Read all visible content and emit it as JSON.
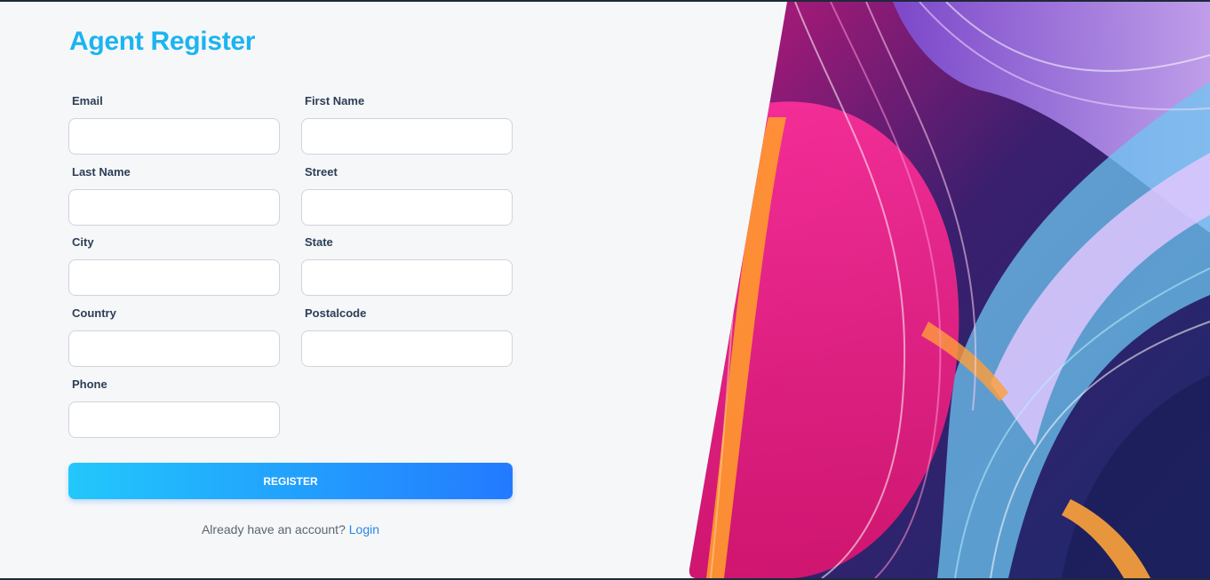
{
  "form": {
    "title": "Agent Register",
    "fields": {
      "email": {
        "label": "Email",
        "value": "",
        "placeholder": ""
      },
      "first_name": {
        "label": "First Name",
        "value": "",
        "placeholder": ""
      },
      "last_name": {
        "label": "Last Name",
        "value": "",
        "placeholder": ""
      },
      "street": {
        "label": "Street",
        "value": "",
        "placeholder": ""
      },
      "city": {
        "label": "City",
        "value": "",
        "placeholder": ""
      },
      "state": {
        "label": "State",
        "value": "",
        "placeholder": ""
      },
      "country": {
        "label": "Country",
        "value": "",
        "placeholder": ""
      },
      "postalcode": {
        "label": "Postalcode",
        "value": "",
        "placeholder": ""
      },
      "phone": {
        "label": "Phone",
        "value": "",
        "placeholder": ""
      }
    },
    "register_label": "REGISTER",
    "already_text": "Already have an account?",
    "login_label": "Login"
  },
  "colors": {
    "title": "#1cb4f0",
    "button_start": "#22c8fb",
    "button_end": "#237aff",
    "link": "#2a86e8"
  }
}
